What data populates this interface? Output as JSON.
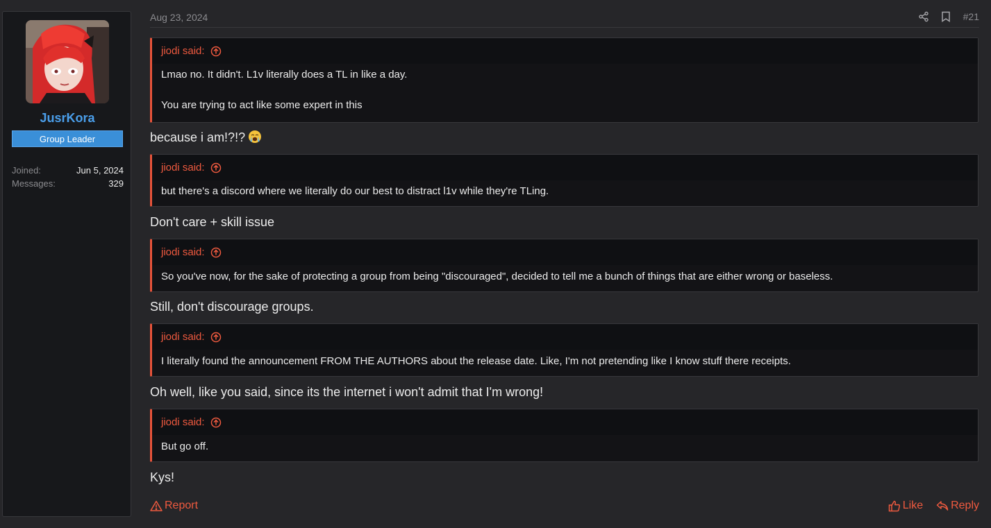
{
  "user": {
    "name": "JusrKora",
    "title": "Group Leader",
    "joined_label": "Joined:",
    "joined_value": "Jun 5, 2024",
    "messages_label": "Messages:",
    "messages_value": "329"
  },
  "post": {
    "date": "Aug 23, 2024",
    "number": "#21",
    "icons": {
      "share": "share-icon",
      "bookmark": "bookmark-icon"
    }
  },
  "quotes": [
    {
      "author": "jiodi said:",
      "lines": [
        "Lmao no. It didn't. L1v literally does a TL in like a day.",
        "You are trying to act like some expert in this"
      ]
    },
    {
      "author": "jiodi said:",
      "lines": [
        "but there's a discord where we literally do our best to distract l1v while they're TLing."
      ]
    },
    {
      "author": "jiodi said:",
      "lines": [
        "So you've now, for the sake of protecting a group from being \"discouraged\", decided to tell me a bunch of things that are either wrong or baseless."
      ]
    },
    {
      "author": "jiodi said:",
      "lines": [
        "I literally found the announcement FROM THE AUTHORS about the release date. Like, I'm not pretending like I know stuff there receipts."
      ]
    },
    {
      "author": "jiodi said:",
      "lines": [
        "But go off."
      ]
    }
  ],
  "replies": [
    "because i am!?!?",
    "Don't care + skill issue",
    "Still, don't discourage groups.",
    "Oh well, like you said, since its the internet i won't admit that I'm wrong!",
    "Kys!"
  ],
  "footer": {
    "report": "Report",
    "like": "Like",
    "reply": "Reply"
  },
  "colors": {
    "accent": "#f05a3f",
    "username": "#4a9eea",
    "badge": "#3a8fd8",
    "background": "#262629"
  }
}
